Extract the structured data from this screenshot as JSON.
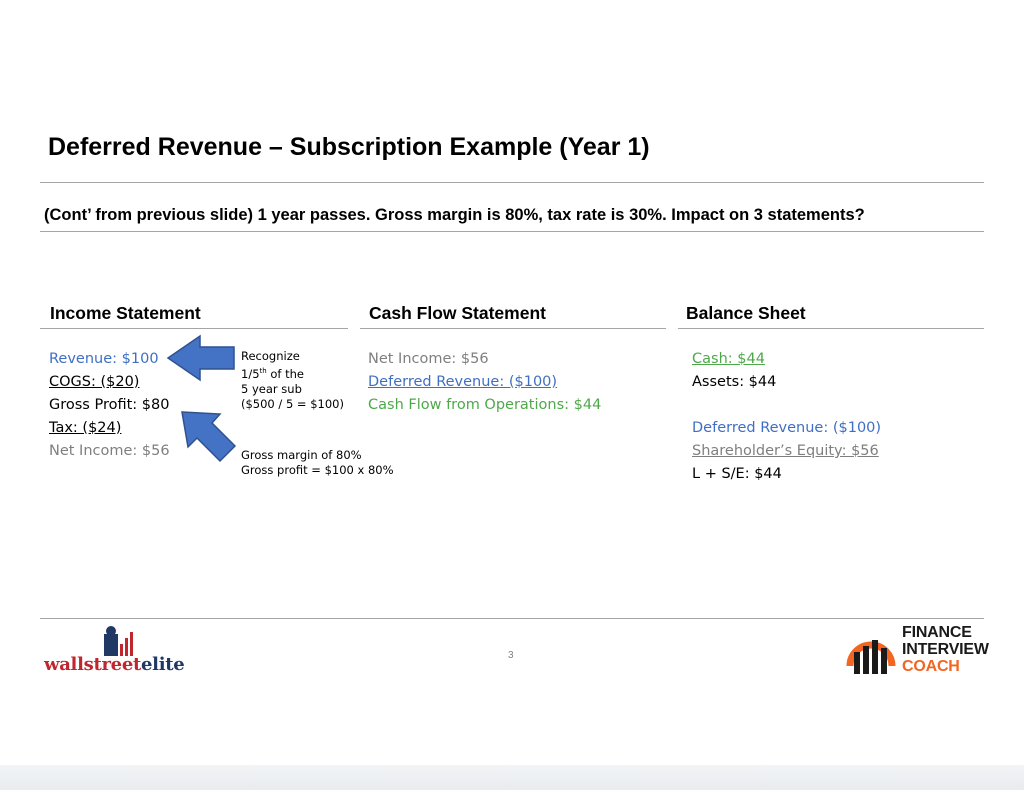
{
  "slide": {
    "title": "Deferred Revenue – Subscription Example (Year 1)",
    "subtitle": "(Cont’ from previous slide) 1 year passes. Gross margin is 80%, tax rate is 30%. Impact on 3 statements?",
    "page_number": "3"
  },
  "income_statement": {
    "heading": "Income Statement",
    "revenue": "Revenue: $100",
    "cogs": "COGS: ($20)",
    "gross_profit": "Gross Profit: $80",
    "tax": "Tax: ($24)",
    "net_income": "Net Income: $56"
  },
  "cash_flow_statement": {
    "heading": "Cash Flow Statement",
    "net_income": "Net Income: $56",
    "deferred_revenue": "Deferred Revenue: ($100)",
    "cfo": "Cash Flow from Operations: $44"
  },
  "balance_sheet": {
    "heading": "Balance Sheet",
    "cash": "Cash: $44",
    "assets": "Assets: $44",
    "deferred_revenue": "Deferred Revenue: ($100)",
    "equity": "Shareholder’s Equity: $56",
    "l_se": "L + S/E: $44"
  },
  "annotations": {
    "recognize_line1": "Recognize",
    "recognize_line2_pre": "1/5",
    "recognize_line2_sup": "th",
    "recognize_line2_post": " of the",
    "recognize_line3": "5 year sub",
    "recognize_line4": "($500 / 5 = $100)",
    "gross_line1": "Gross margin of 80%",
    "gross_line2": "Gross profit = $100 x 80%"
  },
  "logos": {
    "left_pre": "wallstreet",
    "left_post": "elite",
    "right_line1": "FINANCE",
    "right_line2": "INTERVIEW",
    "right_line3": "COACH"
  },
  "colors": {
    "blue_text": "#3f6fc3",
    "green_text": "#4ea84a",
    "gray_text": "#7f7f7f",
    "arrow_fill": "#4472c4",
    "arrow_stroke": "#2f528f",
    "wse_red": "#c0262e",
    "wse_navy": "#1f3864",
    "fic_orange": "#f26522"
  }
}
